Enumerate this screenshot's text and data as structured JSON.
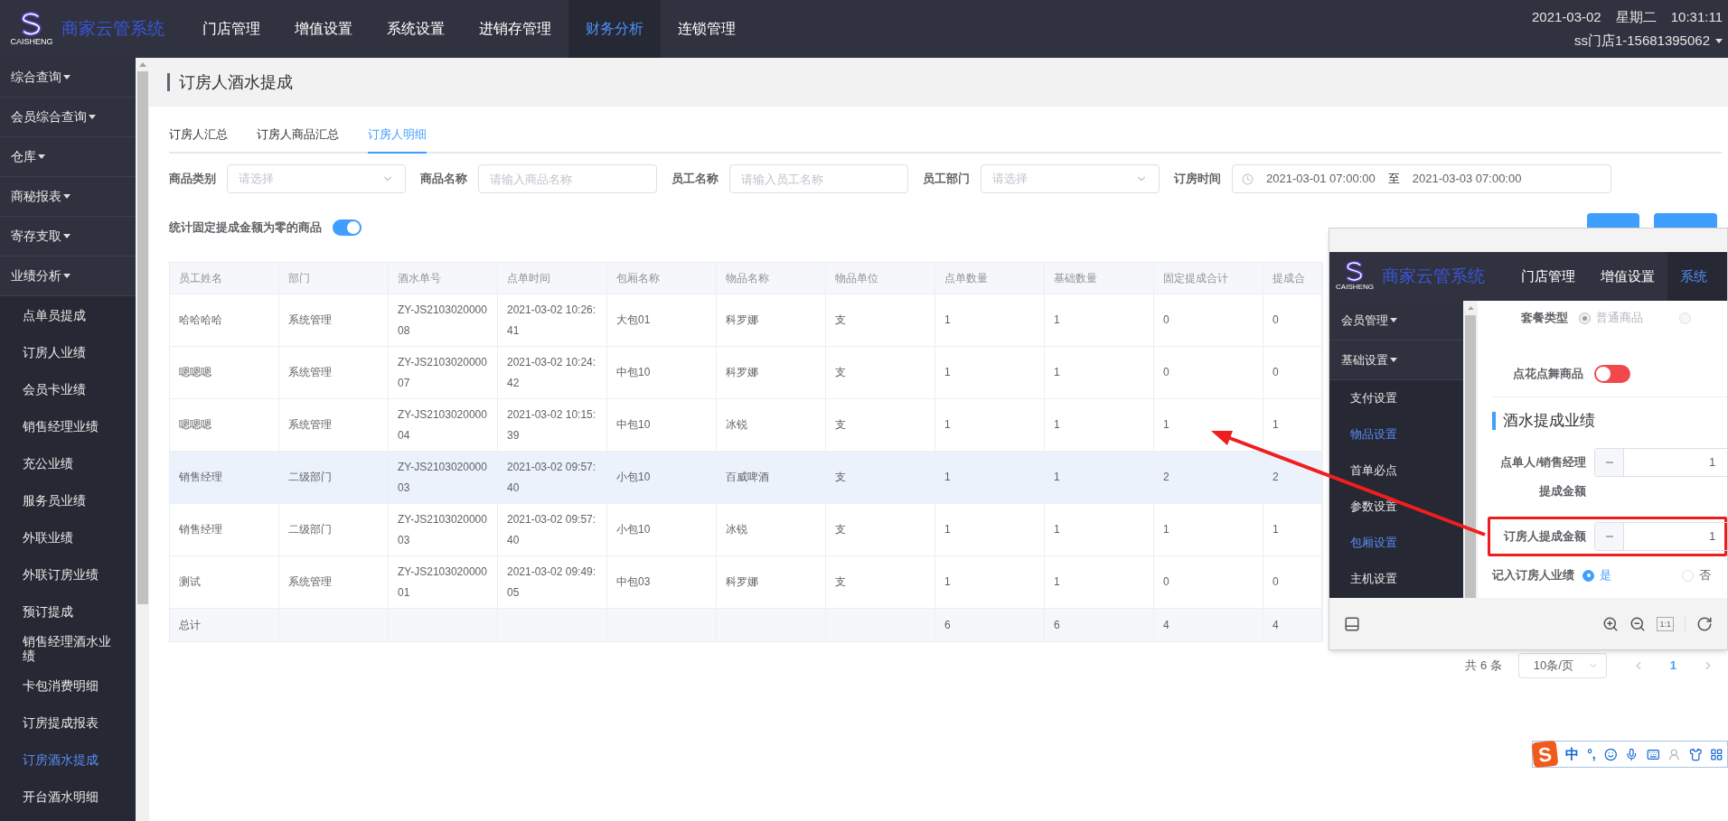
{
  "header": {
    "logo_caption": "CAISHENG",
    "app_name": "商家云管系统",
    "nav": [
      {
        "label": "门店管理",
        "selected": false
      },
      {
        "label": "增值设置",
        "selected": false
      },
      {
        "label": "系统设置",
        "selected": false
      },
      {
        "label": "进销存管理",
        "selected": false
      },
      {
        "label": "财务分析",
        "selected": true
      },
      {
        "label": "连锁管理",
        "selected": false
      }
    ],
    "date": "2021-03-02",
    "weekday": "星期二",
    "time": "10:31:11",
    "store": "ss门店1-15681395062"
  },
  "sidebar": {
    "groups": [
      {
        "label": "综合查询"
      },
      {
        "label": "会员综合查询"
      },
      {
        "label": "仓库"
      },
      {
        "label": "商秘报表"
      },
      {
        "label": "寄存支取"
      },
      {
        "label": "业绩分析",
        "children": [
          {
            "label": "点单员提成",
            "selected": false
          },
          {
            "label": "订房人业绩",
            "selected": false
          },
          {
            "label": "会员卡业绩",
            "selected": false
          },
          {
            "label": "销售经理业绩",
            "selected": false
          },
          {
            "label": "充公业绩",
            "selected": false
          },
          {
            "label": "服务员业绩",
            "selected": false
          },
          {
            "label": "外联业绩",
            "selected": false
          },
          {
            "label": "外联订房业绩",
            "selected": false
          },
          {
            "label": "预订提成",
            "selected": false
          },
          {
            "label": "销售经理酒水业绩",
            "selected": false
          },
          {
            "label": "卡包消费明细",
            "selected": false
          },
          {
            "label": "订房提成报表",
            "selected": false
          },
          {
            "label": "订房酒水提成",
            "selected": true
          },
          {
            "label": "开台酒水明细",
            "selected": false
          }
        ]
      }
    ]
  },
  "page_title": "订房人酒水提成",
  "tabs": [
    {
      "label": "订房人汇总",
      "selected": false
    },
    {
      "label": "订房人商品汇总",
      "selected": false
    },
    {
      "label": "订房人明细",
      "selected": true
    }
  ],
  "filters": [
    {
      "kind": "select",
      "label": "商品类别",
      "placeholder": "请选择"
    },
    {
      "kind": "input",
      "label": "商品名称",
      "placeholder": "请输入商品名称"
    },
    {
      "kind": "input",
      "label": "员工名称",
      "placeholder": "请输入员工名称"
    },
    {
      "kind": "select",
      "label": "员工部门",
      "placeholder": "请选择"
    },
    {
      "kind": "daterange",
      "label": "订房时间",
      "start": "2021-03-01 07:00:00",
      "separator": "至",
      "end": "2021-03-03 07:00:00"
    }
  ],
  "zero_toggle": {
    "label": "统计固定提成金额为零的商品",
    "on": true
  },
  "table": {
    "columns": [
      "员工姓名",
      "部门",
      "酒水单号",
      "点单时间",
      "包厢名称",
      "物品名称",
      "物品单位",
      "点单数量",
      "基础数量",
      "固定提成合计",
      "提成合"
    ],
    "rows": [
      {
        "highlighted": false,
        "cells": [
          "哈哈哈哈",
          "系统管理",
          "ZY-JS210302000008",
          "2021-03-02 10:26:41",
          "大包01",
          "科罗娜",
          "支",
          "1",
          "1",
          "0",
          "0"
        ]
      },
      {
        "highlighted": false,
        "cells": [
          "嗯嗯嗯",
          "系统管理",
          "ZY-JS210302000007",
          "2021-03-02 10:24:42",
          "中包10",
          "科罗娜",
          "支",
          "1",
          "1",
          "0",
          "0"
        ]
      },
      {
        "highlighted": false,
        "cells": [
          "嗯嗯嗯",
          "系统管理",
          "ZY-JS210302000004",
          "2021-03-02 10:15:39",
          "中包10",
          "冰锐",
          "支",
          "1",
          "1",
          "1",
          "1"
        ]
      },
      {
        "highlighted": true,
        "cells": [
          "销售经理",
          "二级部门",
          "ZY-JS210302000003",
          "2021-03-02 09:57:40",
          "小包10",
          "百威啤酒",
          "支",
          "1",
          "1",
          "2",
          "2"
        ]
      },
      {
        "highlighted": false,
        "cells": [
          "销售经理",
          "二级部门",
          "ZY-JS210302000003",
          "2021-03-02 09:57:40",
          "小包10",
          "冰锐",
          "支",
          "1",
          "1",
          "1",
          "1"
        ]
      },
      {
        "highlighted": false,
        "cells": [
          "测试",
          "系统管理",
          "ZY-JS210302000001",
          "2021-03-02 09:49:05",
          "中包03",
          "科罗娜",
          "支",
          "1",
          "1",
          "0",
          "0"
        ]
      }
    ],
    "total_row": {
      "label": "总计",
      "counts": [
        "6",
        "6",
        "4",
        "4"
      ]
    }
  },
  "pagination": {
    "total": "共 6 条",
    "page_size": "10条/页",
    "pages": [
      {
        "label": "1",
        "selected": true
      }
    ]
  },
  "screenshot_viewer": {
    "header": {
      "logo_caption": "CAISHENG",
      "app_name": "商家云管系统",
      "nav": [
        {
          "label": "门店管理",
          "selected": false
        },
        {
          "label": "增值设置",
          "selected": false
        },
        {
          "label": "系统",
          "selected": true
        }
      ]
    },
    "sidebar": {
      "groups": [
        {
          "label": "会员管理"
        },
        {
          "label": "基础设置",
          "children": [
            {
              "label": "支付设置",
              "selected": false
            },
            {
              "label": "物品设置",
              "selected": true
            },
            {
              "label": "首单必点",
              "selected": false
            },
            {
              "label": "参数设置",
              "selected": false
            },
            {
              "label": "包厢设置",
              "selected": true
            },
            {
              "label": "主机设置",
              "selected": false
            }
          ]
        }
      ]
    },
    "form": {
      "package_type": {
        "label": "套餐类型",
        "options": [
          {
            "label": "普通商品",
            "selected": true
          },
          {
            "selected": false
          }
        ]
      },
      "flower_toggle": {
        "label": "点花点舞商品",
        "on": false
      },
      "section_title": "酒水提成业绩",
      "amount_fields": [
        {
          "label": "点单人/销售经理提成金额",
          "value": "1",
          "outlined": false
        },
        {
          "label": "订房人提成金额",
          "value": "1",
          "outlined": true
        }
      ],
      "record": {
        "label": "记入订房人业绩",
        "options": [
          {
            "label": "是",
            "selected": true
          },
          {
            "label": "否",
            "selected": false
          }
        ]
      }
    },
    "toolbar": {
      "ratio_label": "1:1"
    }
  },
  "ime_bar": {
    "logo_letter": "S",
    "mode": "中",
    "punct": "°,"
  }
}
